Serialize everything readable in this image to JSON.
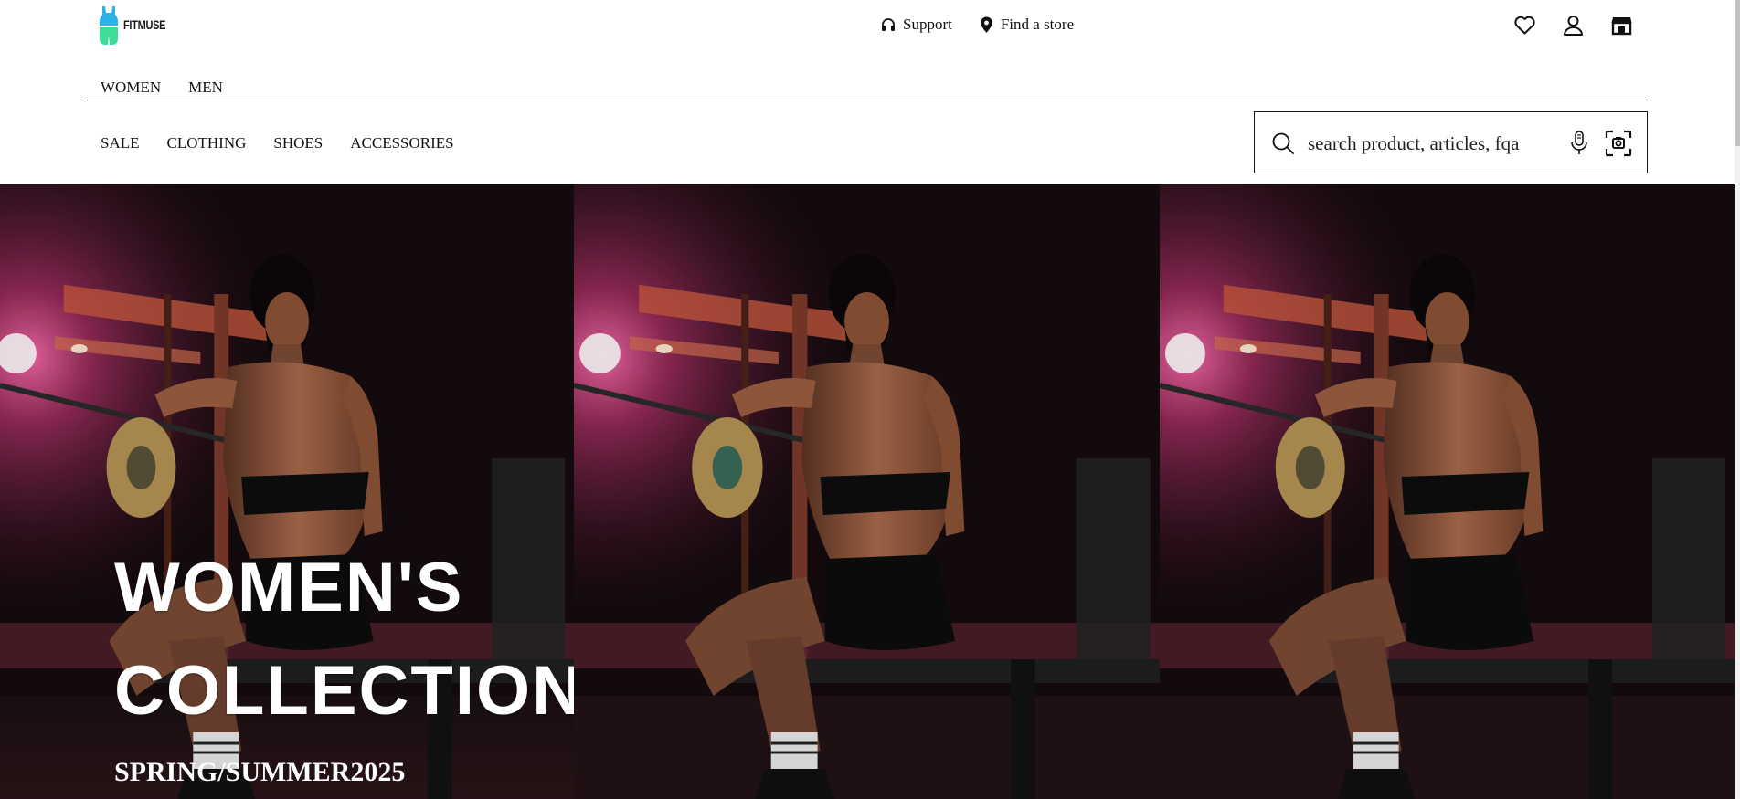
{
  "brand": {
    "name": "FITMUSE",
    "accent": "#2bb3e8",
    "accent_green": "#3ddc97"
  },
  "utility_links": [
    {
      "label": "Support",
      "icon": "headphones-icon"
    },
    {
      "label": "Find a store",
      "icon": "map-pin-icon"
    }
  ],
  "user_icons": [
    "heart-icon",
    "user-icon",
    "store-icon"
  ],
  "gender_nav": [
    "WOMEN",
    "MEN"
  ],
  "category_nav": [
    "SALE",
    "CLOTHING",
    "SHOES",
    "ACCESSORIES"
  ],
  "search": {
    "placeholder": "search product, articles, fqa",
    "value": ""
  },
  "hero": {
    "title_line1": "WOMEN'S",
    "title_line2": "COLLECTION",
    "subtitle": "SPRING/SUMMER2025",
    "panel_count": 3
  }
}
